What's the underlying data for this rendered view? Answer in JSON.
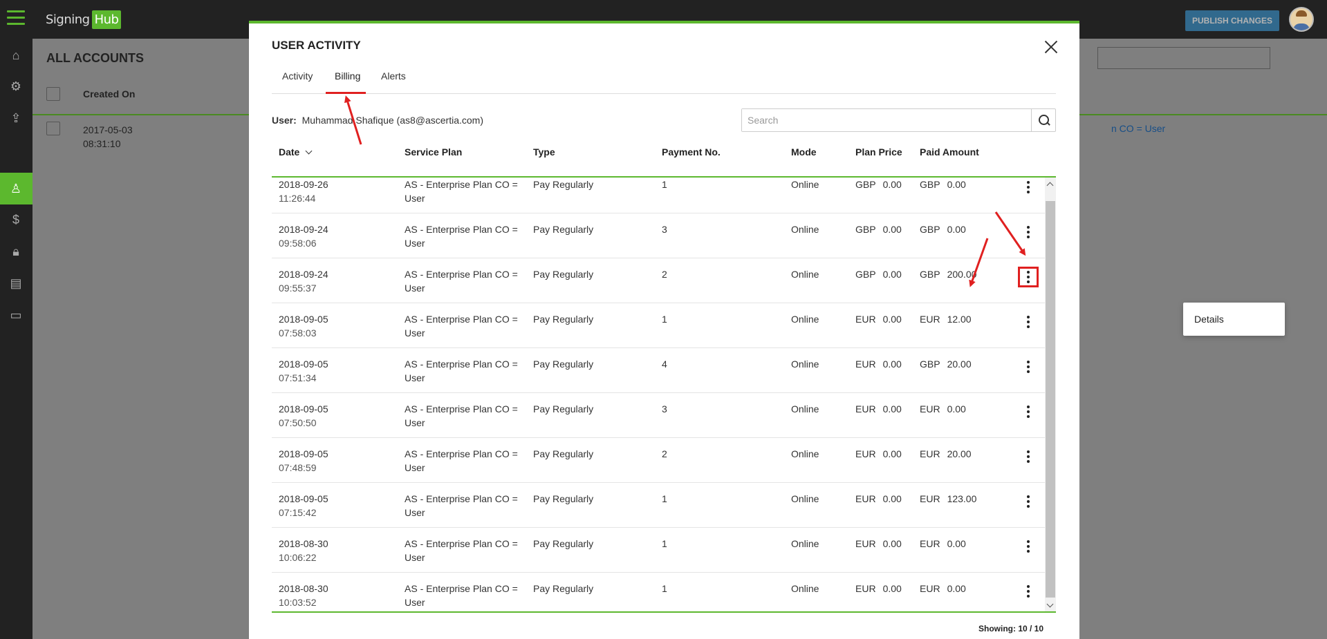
{
  "app": {
    "logo_prefix": "Signing",
    "logo_suffix": "Hub",
    "publish_label": "PUBLISH CHANGES"
  },
  "background": {
    "page_title": "ALL ACCOUNTS",
    "created_on_label": "Created On",
    "row_date": "2017-05-03",
    "row_time": "08:31:10",
    "row_link_text": "n CO = User"
  },
  "modal": {
    "title": "USER ACTIVITY",
    "tabs": [
      {
        "label": "Activity"
      },
      {
        "label": "Billing"
      },
      {
        "label": "Alerts"
      }
    ],
    "active_tab": "Billing",
    "user_label": "User:",
    "user_value": "Muhammad Shafique (as8@ascertia.com)",
    "search_placeholder": "Search",
    "columns": [
      "Date",
      "Service Plan",
      "Type",
      "Payment No.",
      "Mode",
      "Plan Price",
      "Paid Amount"
    ],
    "rows": [
      {
        "date": "2018-09-26",
        "time": "11:26:44",
        "plan_line1": "AS - Enterprise Plan CO =",
        "plan_line2": "User",
        "type": "Pay Regularly",
        "payment_no": "1",
        "mode": "Online",
        "price_cur": "GBP",
        "price": "0.00",
        "paid_cur": "GBP",
        "paid": "0.00"
      },
      {
        "date": "2018-09-24",
        "time": "09:58:06",
        "plan_line1": "AS - Enterprise Plan CO =",
        "plan_line2": "User",
        "type": "Pay Regularly",
        "payment_no": "3",
        "mode": "Online",
        "price_cur": "GBP",
        "price": "0.00",
        "paid_cur": "GBP",
        "paid": "0.00"
      },
      {
        "date": "2018-09-24",
        "time": "09:55:37",
        "plan_line1": "AS - Enterprise Plan CO =",
        "plan_line2": "User",
        "type": "Pay Regularly",
        "payment_no": "2",
        "mode": "Online",
        "price_cur": "GBP",
        "price": "0.00",
        "paid_cur": "GBP",
        "paid": "200.00"
      },
      {
        "date": "2018-09-05",
        "time": "07:58:03",
        "plan_line1": "AS - Enterprise Plan CO =",
        "plan_line2": "User",
        "type": "Pay Regularly",
        "payment_no": "1",
        "mode": "Online",
        "price_cur": "EUR",
        "price": "0.00",
        "paid_cur": "EUR",
        "paid": "12.00"
      },
      {
        "date": "2018-09-05",
        "time": "07:51:34",
        "plan_line1": "AS - Enterprise Plan CO =",
        "plan_line2": "User",
        "type": "Pay Regularly",
        "payment_no": "4",
        "mode": "Online",
        "price_cur": "EUR",
        "price": "0.00",
        "paid_cur": "GBP",
        "paid": "20.00"
      },
      {
        "date": "2018-09-05",
        "time": "07:50:50",
        "plan_line1": "AS - Enterprise Plan CO =",
        "plan_line2": "User",
        "type": "Pay Regularly",
        "payment_no": "3",
        "mode": "Online",
        "price_cur": "EUR",
        "price": "0.00",
        "paid_cur": "EUR",
        "paid": "0.00"
      },
      {
        "date": "2018-09-05",
        "time": "07:48:59",
        "plan_line1": "AS - Enterprise Plan CO =",
        "plan_line2": "User",
        "type": "Pay Regularly",
        "payment_no": "2",
        "mode": "Online",
        "price_cur": "EUR",
        "price": "0.00",
        "paid_cur": "EUR",
        "paid": "20.00"
      },
      {
        "date": "2018-09-05",
        "time": "07:15:42",
        "plan_line1": "AS - Enterprise Plan CO =",
        "plan_line2": "User",
        "type": "Pay Regularly",
        "payment_no": "1",
        "mode": "Online",
        "price_cur": "EUR",
        "price": "0.00",
        "paid_cur": "EUR",
        "paid": "123.00"
      },
      {
        "date": "2018-08-30",
        "time": "10:06:22",
        "plan_line1": "AS - Enterprise Plan CO =",
        "plan_line2": "User",
        "type": "Pay Regularly",
        "payment_no": "1",
        "mode": "Online",
        "price_cur": "EUR",
        "price": "0.00",
        "paid_cur": "EUR",
        "paid": "0.00"
      },
      {
        "date": "2018-08-30",
        "time": "10:03:52",
        "plan_line1": "AS - Enterprise Plan CO =",
        "plan_line2": "User",
        "type": "Pay Regularly",
        "payment_no": "1",
        "mode": "Online",
        "price_cur": "EUR",
        "price": "0.00",
        "paid_cur": "EUR",
        "paid": "0.00"
      }
    ],
    "dropdown_item": "Details",
    "showing": "Showing: 10 / 10"
  },
  "colors": {
    "accent_green": "#5cb82e",
    "annotation_red": "#e02020",
    "publish_blue": "#3a8fc7"
  },
  "icons": [
    "menu-icon",
    "home-icon",
    "gear-icon",
    "upload-icon",
    "user-icon",
    "dollar-icon",
    "lock-icon",
    "clipboard-icon",
    "document-icon",
    "close-icon",
    "search-icon",
    "more-vertical-icon"
  ]
}
